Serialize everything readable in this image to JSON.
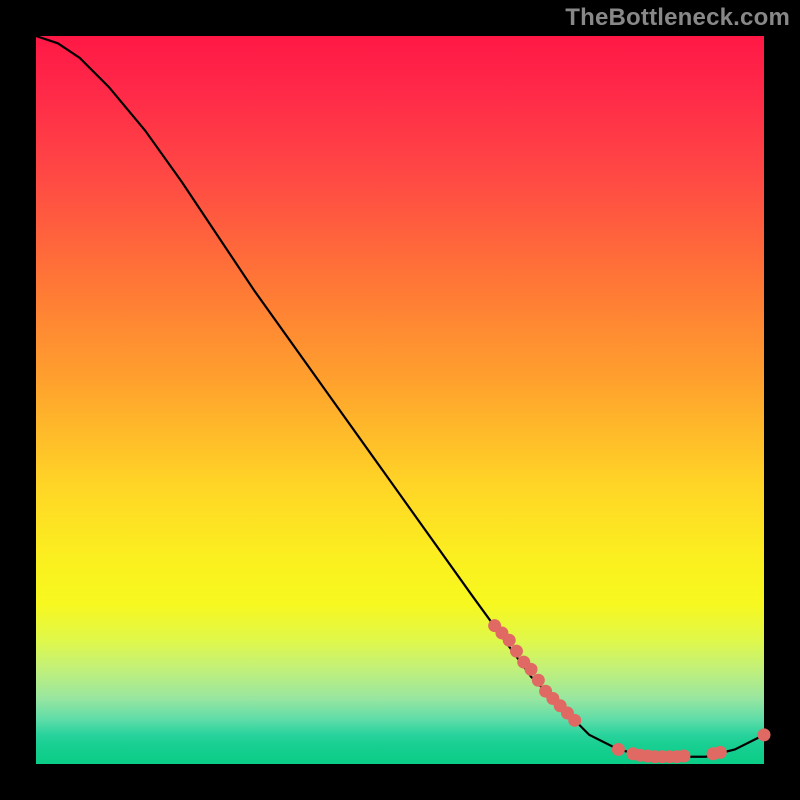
{
  "watermark": "TheBottleneck.com",
  "chart_data": {
    "type": "line",
    "title": "",
    "xlabel": "",
    "ylabel": "",
    "xlim": [
      0,
      100
    ],
    "ylim": [
      0,
      100
    ],
    "grid": false,
    "legend": false,
    "series": [
      {
        "name": "curve",
        "x": [
          0,
          3,
          6,
          10,
          15,
          20,
          30,
          40,
          50,
          60,
          68,
          72,
          76,
          80,
          84,
          88,
          92,
          96,
          100
        ],
        "y": [
          100,
          99,
          97,
          93,
          87,
          80,
          65,
          51,
          37,
          23,
          12,
          8,
          4,
          2,
          1,
          1,
          1,
          2,
          4
        ]
      }
    ],
    "points": {
      "name": "highlight-dots",
      "x": [
        63,
        64,
        65,
        66,
        67,
        68,
        69,
        70,
        71,
        72,
        73,
        74,
        80,
        82,
        83,
        84,
        85,
        86,
        87,
        88,
        89,
        93,
        94,
        100
      ],
      "y": [
        19,
        18,
        17,
        15.5,
        14,
        13,
        11.5,
        10,
        9,
        8,
        7,
        6,
        2,
        1.4,
        1.2,
        1.1,
        1.0,
        1.0,
        1.0,
        1.0,
        1.1,
        1.4,
        1.6,
        4
      ]
    }
  }
}
